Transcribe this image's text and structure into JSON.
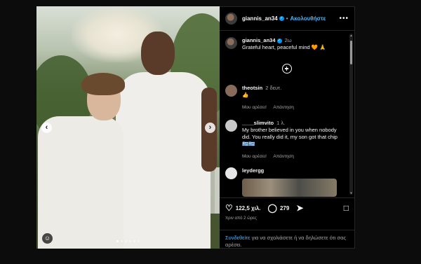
{
  "post": {
    "username": "giannis_an34",
    "follow_label": "Ακολουθήστε",
    "separator": "•",
    "more": "•••",
    "caption": {
      "username": "giannis_an34",
      "time": "2ω",
      "text": "Grateful heart, peaceful mind 🧡 🙏"
    },
    "image": {
      "prev": "‹",
      "next": "›",
      "slides_count": 6,
      "active_slide": 1
    }
  },
  "comments": [
    {
      "username": "theotsin",
      "time": "2 δευτ.",
      "text": "👍",
      "like_label": "Μου αρέσει!",
      "reply_label": "Απάντηση",
      "avatar_color": "#8a6a5a"
    },
    {
      "username": "____slimvito",
      "time": "1 λ.",
      "text": "My brother believed in you when nobody did. You really did it, my son got that chip 🇬🇷🇬🇷",
      "like_label": "Μου αρέσει!",
      "reply_label": "Απάντηση",
      "avatar_color": "#c9c9c9"
    },
    {
      "username": "leydergg",
      "time": "",
      "text": "",
      "avatar_color": "#e6e6e6"
    }
  ],
  "footer": {
    "likes": "122,5 χιλ.",
    "comments": "279",
    "when": "πριν από 2 ώρες",
    "login_link": "Συνδεθείτε",
    "login_text": " για να σχολιάσετε ή να δηλώσετε ότι σας αρέσει."
  },
  "colors": {
    "accent": "#0095f6",
    "link": "#4cb5f9",
    "background": "#000000"
  },
  "icons": [
    "ellipsis-icon",
    "verified-icon",
    "add-comment-icon",
    "heart-icon",
    "comment-icon",
    "share-icon",
    "bookmark-icon",
    "tag-user-icon"
  ]
}
